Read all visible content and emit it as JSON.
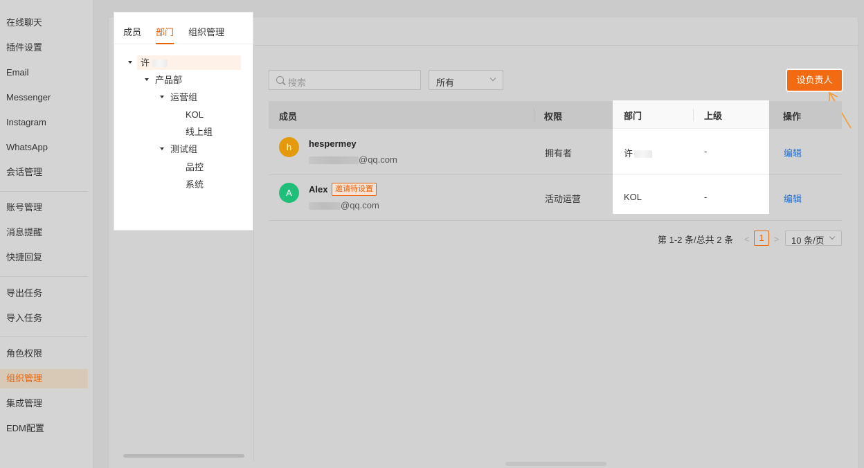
{
  "sidebar": {
    "items": [
      {
        "label": "在线聊天"
      },
      {
        "label": "插件设置"
      },
      {
        "label": "Email"
      },
      {
        "label": "Messenger"
      },
      {
        "label": "Instagram"
      },
      {
        "label": "WhatsApp"
      },
      {
        "label": "会话管理"
      },
      {
        "label": "账号管理"
      },
      {
        "label": "消息提醒"
      },
      {
        "label": "快捷回复"
      },
      {
        "label": "导出任务"
      },
      {
        "label": "导入任务"
      },
      {
        "label": "角色权限"
      },
      {
        "label": "组织管理",
        "active": true
      },
      {
        "label": "集成管理"
      },
      {
        "label": "EDM配置"
      }
    ]
  },
  "tabs": [
    {
      "label": "成员"
    },
    {
      "label": "部门",
      "active": true
    },
    {
      "label": "组织管理"
    }
  ],
  "tree": {
    "root": "许",
    "nodes": [
      {
        "label": "产品部"
      },
      {
        "label": "运营组"
      },
      {
        "label": "KOL"
      },
      {
        "label": "线上组"
      },
      {
        "label": "测试组"
      },
      {
        "label": "品控"
      },
      {
        "label": "系统"
      }
    ]
  },
  "search": {
    "placeholder": "搜索"
  },
  "filter": {
    "value": "所有"
  },
  "toolbar": {
    "primary_label": "设负责人"
  },
  "table": {
    "headers": {
      "member": "成员",
      "permission": "权限",
      "department": "部门",
      "superior": "上级",
      "action": "操作"
    },
    "rows": [
      {
        "avatar": "h",
        "avatar_color": "#e39a0c",
        "name": "hespermey",
        "email": "@qq.com",
        "permission": "拥有者",
        "department": "许",
        "superior": "-",
        "action": "编辑"
      },
      {
        "avatar": "A",
        "avatar_color": "#1fbf7a",
        "name": "Alex",
        "badge": "邀请待设置",
        "email": "@qq.com",
        "permission": "活动运营",
        "department": "KOL",
        "superior": "-",
        "action": "编辑"
      }
    ]
  },
  "pagination": {
    "summary": "第 1-2 条/总共 2 条",
    "prev": "<",
    "next": ">",
    "current_page": "1",
    "page_size": "10 条/页"
  },
  "colors": {
    "accent": "#e8620a",
    "link": "#1f6fd6",
    "annotation_arrow": "#f0a040"
  }
}
